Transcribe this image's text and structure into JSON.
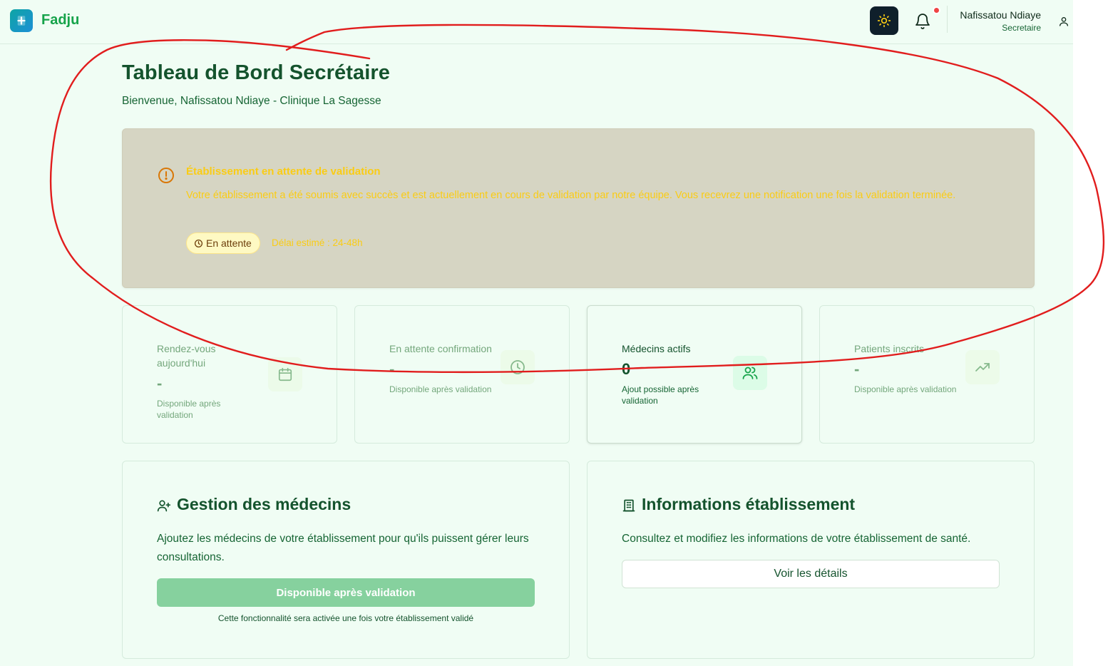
{
  "header": {
    "app_name": "Fadju",
    "user_name": "Nafissatou Ndiaye",
    "user_role": "Secretaire",
    "icons": [
      "plus-logo-icon",
      "sun-icon",
      "bell-icon",
      "user-icon"
    ],
    "notification_dot": true
  },
  "page": {
    "title": "Tableau de Bord Secrétaire",
    "subtitle": "Bienvenue, Nafissatou Ndiaye - Clinique La Sagesse"
  },
  "alert": {
    "title": "Établissement en attente de validation",
    "message": "Votre établissement a été soumis avec succès et est actuellement en cours de validation par notre équipe. Vous recevrez une notification une fois la validation terminée.",
    "status_badge": "En attente",
    "delay": "Délai estimé : 24-48h"
  },
  "stats": [
    {
      "label": "Rendez-vous aujourd'hui",
      "value": "-",
      "note": "Disponible après validation",
      "icon": "calendar-icon"
    },
    {
      "label": "En attente confirmation",
      "value": "-",
      "note": "Disponible après validation",
      "icon": "clock-icon"
    },
    {
      "label": "Médecins actifs",
      "value": "0",
      "note": "Ajout possible après validation",
      "icon": "users-icon"
    },
    {
      "label": "Patients inscrits",
      "value": "-",
      "note": "Disponible après validation",
      "icon": "trending-up-icon"
    }
  ],
  "doctors_card": {
    "title": "Gestion des médecins",
    "text": "Ajoutez les médecins de votre établissement pour qu'ils puissent gérer leurs consultations.",
    "button": "Disponible après validation",
    "note": "Cette fonctionnalité sera activée une fois votre établissement validé"
  },
  "establishment_card": {
    "title": "Informations établissement",
    "text": "Consultez et modifiez les informations de votre établissement de santé.",
    "button": "Voir les détails"
  },
  "colors": {
    "brand": "#16a34a",
    "background": "#f0fdf4",
    "heading": "#14532d",
    "alert_bg": "#d6d5c3",
    "alert_text": "#facc15",
    "annotation": "#e11d1d"
  }
}
